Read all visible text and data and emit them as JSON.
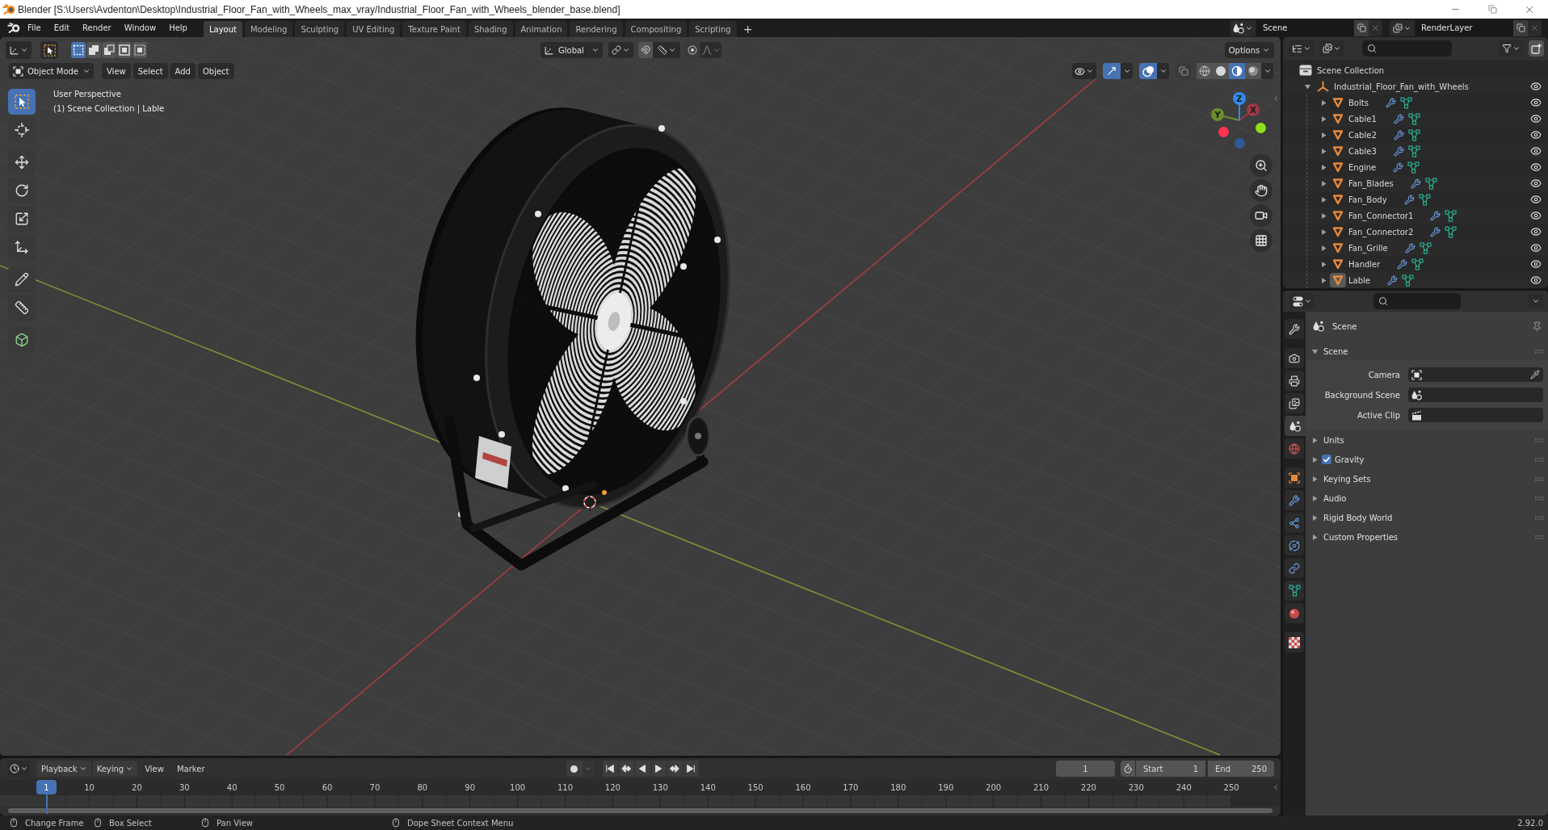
{
  "window": {
    "title": "Blender [S:\\Users\\Avdenton\\Desktop\\Industrial_Floor_Fan_with_Wheels_max_vray/Industrial_Floor_Fan_with_Wheels_blender_base.blend]"
  },
  "top_bar": {
    "menus": [
      "File",
      "Edit",
      "Render",
      "Window",
      "Help"
    ],
    "workspaces": [
      {
        "label": "Layout",
        "selected": true
      },
      {
        "label": "Modeling",
        "selected": false
      },
      {
        "label": "Sculpting",
        "selected": false
      },
      {
        "label": "UV Editing",
        "selected": false
      },
      {
        "label": "Texture Paint",
        "selected": false
      },
      {
        "label": "Shading",
        "selected": false
      },
      {
        "label": "Animation",
        "selected": false
      },
      {
        "label": "Rendering",
        "selected": false
      },
      {
        "label": "Compositing",
        "selected": false
      },
      {
        "label": "Scripting",
        "selected": false
      }
    ],
    "add_workspace": "+",
    "scene": "Scene",
    "view_layer": "RenderLayer"
  },
  "tool_header": {
    "select_modes": [
      {
        "kind": "set",
        "selected": true
      },
      {
        "kind": "extend",
        "selected": false
      },
      {
        "kind": "subtract",
        "selected": false
      },
      {
        "kind": "invert",
        "selected": false
      },
      {
        "kind": "intersect",
        "selected": false
      }
    ],
    "orientation": "Global",
    "options": "Options"
  },
  "viewport_header": {
    "mode": "Object Mode",
    "menus": [
      "View",
      "Select",
      "Add",
      "Object"
    ],
    "toggles": [
      {
        "kind": "gizmos",
        "on": true
      },
      {
        "kind": "overlays",
        "on": true
      },
      {
        "kind": "xray",
        "on": false
      }
    ],
    "shading": [
      {
        "kind": "wireframe",
        "selected": false
      },
      {
        "kind": "solid",
        "selected": false
      },
      {
        "kind": "material",
        "selected": true
      },
      {
        "kind": "rendered",
        "selected": false
      }
    ]
  },
  "toolbar": [
    [
      {
        "kind": "select_box",
        "selected": true
      },
      {
        "kind": "cursor",
        "selected": false
      }
    ],
    [
      {
        "kind": "move",
        "selected": false
      },
      {
        "kind": "rotate",
        "selected": false
      },
      {
        "kind": "scale",
        "selected": false
      },
      {
        "kind": "transform",
        "selected": false
      }
    ],
    [
      {
        "kind": "annotate",
        "selected": false
      },
      {
        "kind": "measure",
        "selected": false
      }
    ],
    [
      {
        "kind": "add_cube",
        "selected": false
      }
    ]
  ],
  "viewport": {
    "view_name": "User Perspective",
    "context": "(1) Scene Collection | Lable",
    "gizmo_axes": [
      "X",
      "Y",
      "Z"
    ]
  },
  "timeline": {
    "menus": [
      {
        "kind": "dropdown",
        "label": "Playback"
      },
      {
        "kind": "dropdown",
        "label": "Keying"
      },
      {
        "kind": "menu",
        "label": "View"
      },
      {
        "kind": "menu",
        "label": "Marker"
      }
    ],
    "current_frame": "1",
    "start_label": "Start",
    "start": "1",
    "end_label": "End",
    "end": "250",
    "playhead": "1",
    "ruler_labels": [
      "10",
      "20",
      "30",
      "40",
      "50",
      "60",
      "70",
      "80",
      "90",
      "100",
      "110",
      "120",
      "130",
      "140",
      "150",
      "160",
      "170",
      "180",
      "190",
      "200",
      "210",
      "220",
      "230",
      "240",
      "250"
    ]
  },
  "status_bar": {
    "hints": [
      "Change Frame",
      "Box Select",
      "Pan View",
      "Dope Sheet Context Menu"
    ],
    "version": "2.92.0"
  },
  "outliner": {
    "root": "Scene Collection",
    "collections": [
      {
        "name": "Industrial_Floor_Fan_with_Wheels",
        "expanded": true,
        "children": [
          {
            "name": "Bolts",
            "expanded": false,
            "selected": false
          },
          {
            "name": "Cable1",
            "expanded": false,
            "selected": false
          },
          {
            "name": "Cable2",
            "expanded": false,
            "selected": false
          },
          {
            "name": "Cable3",
            "expanded": false,
            "selected": false
          },
          {
            "name": "Engine",
            "expanded": false,
            "selected": false
          },
          {
            "name": "Fan_Blades",
            "expanded": false,
            "selected": false
          },
          {
            "name": "Fan_Body",
            "expanded": false,
            "selected": false
          },
          {
            "name": "Fan_Connector1",
            "expanded": false,
            "selected": false
          },
          {
            "name": "Fan_Connector2",
            "expanded": false,
            "selected": false
          },
          {
            "name": "Fan_Grille",
            "expanded": false,
            "selected": false
          },
          {
            "name": "Handler",
            "expanded": false,
            "selected": false
          },
          {
            "name": "Lable",
            "expanded": false,
            "selected": true
          }
        ]
      }
    ]
  },
  "properties": {
    "tabs": [
      [
        {
          "kind": "tool",
          "selected": false
        }
      ],
      [
        {
          "kind": "render",
          "selected": false
        },
        {
          "kind": "output",
          "selected": false
        },
        {
          "kind": "view_layer",
          "selected": false
        },
        {
          "kind": "scene",
          "selected": true
        },
        {
          "kind": "world",
          "selected": false
        }
      ],
      [
        {
          "kind": "object",
          "selected": false
        },
        {
          "kind": "modifiers",
          "selected": false
        },
        {
          "kind": "particles",
          "selected": false
        },
        {
          "kind": "physics",
          "selected": false
        },
        {
          "kind": "constraints",
          "selected": false
        },
        {
          "kind": "data",
          "selected": false
        },
        {
          "kind": "material",
          "selected": false
        }
      ],
      [
        {
          "kind": "texture",
          "selected": false
        }
      ]
    ],
    "context": "Scene",
    "panels": [
      {
        "title": "Scene",
        "expanded": true,
        "fields": [
          {
            "kind": "object",
            "label": "Camera"
          },
          {
            "kind": "scene",
            "label": "Background Scene"
          },
          {
            "kind": "clip",
            "label": "Active Clip"
          }
        ]
      },
      {
        "title": "Units",
        "expanded": false
      },
      {
        "title": "Gravity",
        "expanded": false,
        "checkbox": {
          "checked": true
        }
      },
      {
        "title": "Keying Sets",
        "expanded": false
      },
      {
        "title": "Audio",
        "expanded": false
      },
      {
        "title": "Rigid Body World",
        "expanded": false
      },
      {
        "title": "Custom Properties",
        "expanded": false
      }
    ]
  }
}
